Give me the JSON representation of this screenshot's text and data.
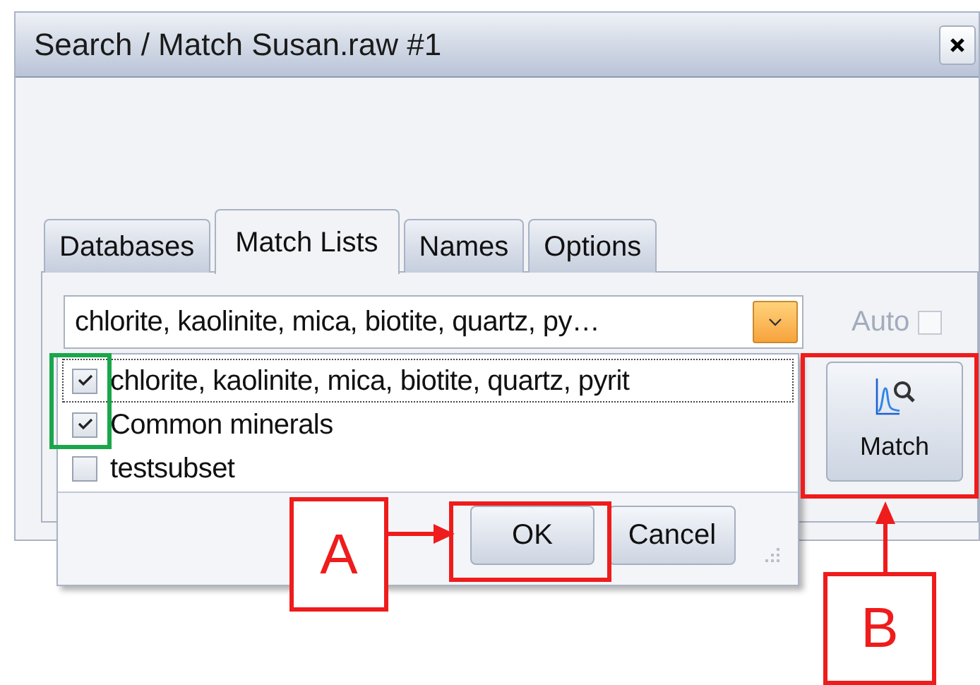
{
  "window": {
    "title": "Search / Match Susan.raw #1"
  },
  "tabs": [
    {
      "label": "Databases",
      "selected": false
    },
    {
      "label": "Match Lists",
      "selected": true
    },
    {
      "label": "Names",
      "selected": false
    },
    {
      "label": "Options",
      "selected": false
    }
  ],
  "match_list": {
    "value": "chlorite, kaolinite, mica, biotite, quartz, py…"
  },
  "auto": {
    "label": "Auto",
    "checked": false,
    "disabled": true
  },
  "dropdown_items": [
    {
      "label": "chlorite, kaolinite, mica, biotite, quartz, pyrit",
      "checked": true,
      "focused": true
    },
    {
      "label": "Common minerals",
      "checked": true,
      "focused": false
    },
    {
      "label": "testsubset",
      "checked": false,
      "focused": false
    }
  ],
  "dropdown_buttons": [
    "OK",
    "Cancel"
  ],
  "match_button": {
    "label": "Match"
  },
  "annotations": [
    {
      "kind": "highlight",
      "color": "#1aa64a"
    },
    {
      "kind": "highlight",
      "color": "#ee1c1c"
    },
    {
      "kind": "highlight",
      "color": "#ee1c1c"
    },
    {
      "kind": "label",
      "text": "A"
    },
    {
      "kind": "label",
      "text": "B"
    },
    {
      "kind": "arrow"
    },
    {
      "kind": "arrow"
    }
  ]
}
